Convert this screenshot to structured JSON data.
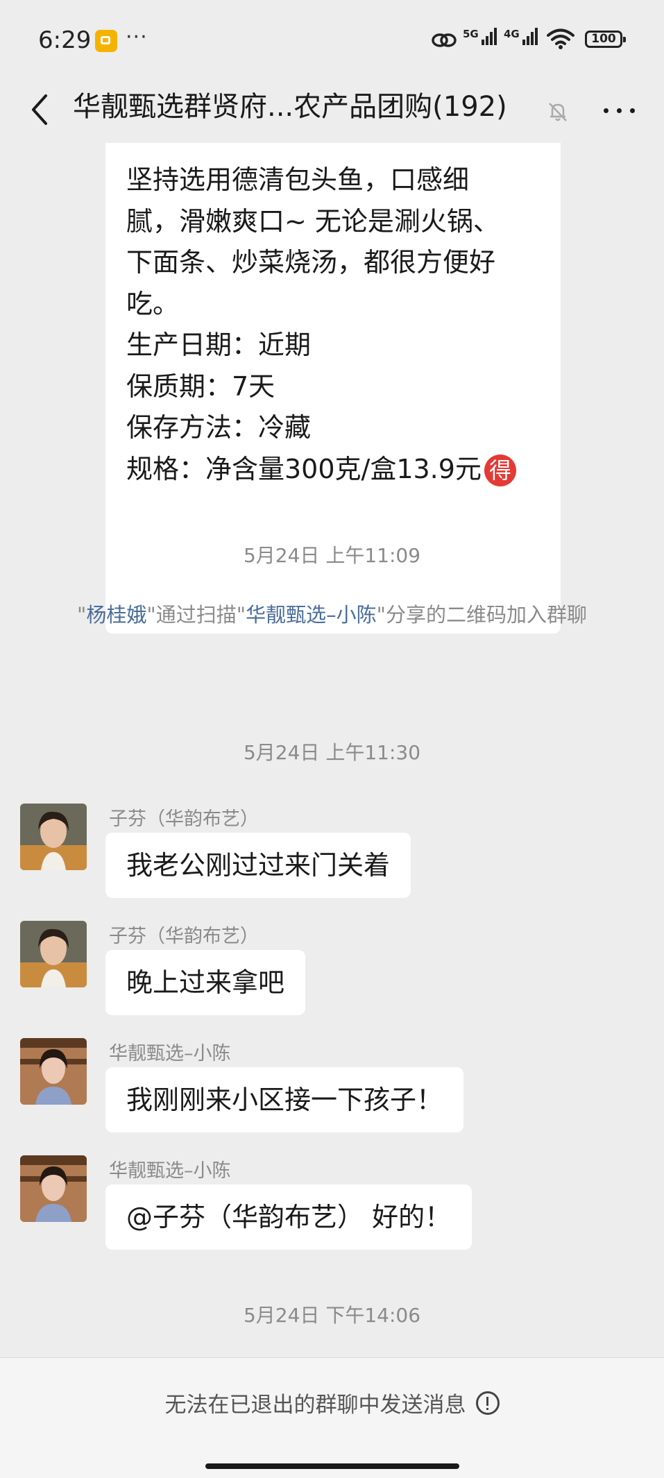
{
  "status_bar": {
    "time": "6:29",
    "signal_1_label": "5G",
    "signal_2_label": "4G",
    "battery": "100",
    "notification_icons": [
      "gallery-app-icon",
      "more-notifications-icon"
    ]
  },
  "header": {
    "title": "华靓甄选群贤府...农产品团购(192)",
    "icons": [
      "back-arrow-icon",
      "muted-bell-icon",
      "more-options-icon"
    ]
  },
  "messages": {
    "product_message": {
      "lines": [
        "坚持选用德清包头鱼，口感细",
        "腻，滑嫩爽口~ 无论是涮火锅、",
        "下面条、炒菜烧汤，都很方便好",
        "吃。",
        "生产日期：近期",
        "保质期：7天",
        "保存方法：冷藏",
        "规格：净含量300克/盒13.9元"
      ],
      "badge": "得"
    },
    "timestamps": [
      "5月24日 上午11:09",
      "5月24日 上午11:30",
      "5月24日 下午14:06"
    ],
    "system_notice": {
      "q1": "\"",
      "name1": "杨桂娥",
      "mid": "\"通过扫描\"",
      "name2": "华靓甄选–小陈",
      "tail": "\"分享的二维码加入群聊"
    },
    "chat": [
      {
        "sender": "子芬（华韵布艺）",
        "text": "我老公刚过过来门关着"
      },
      {
        "sender": "子芬（华韵布艺）",
        "text": "晚上过来拿吧"
      },
      {
        "sender": "华靓甄选–小陈",
        "text": "我刚刚来小区接一下孩子！"
      },
      {
        "sender": "华靓甄选–小陈",
        "text": "@子芬（华韵布艺） 好的！"
      }
    ]
  },
  "footer": {
    "notice": "无法在已退出的群聊中发送消息"
  },
  "colors": {
    "background": "#ededed",
    "bubble": "#ffffff",
    "link_name": "#4a6d9a",
    "badge_red": "#e53935"
  }
}
